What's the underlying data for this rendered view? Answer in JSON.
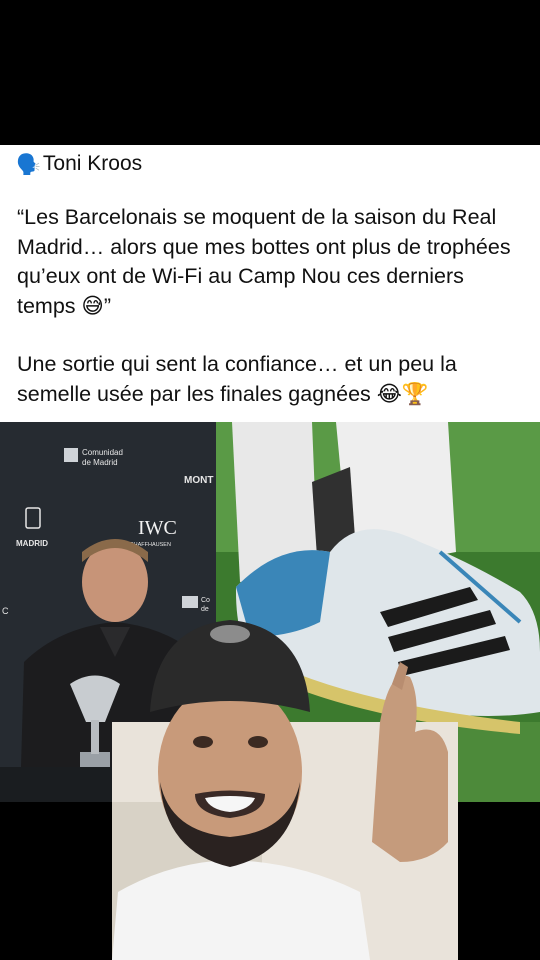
{
  "post": {
    "author_emoji": "🗣️",
    "author_name": "Toni Kroos",
    "quote": "“Les Barcelonais se moquent de la saison du Real Madrid… alors que mes bottes ont plus de trophées qu’eux ont de Wi-Fi au Camp Nou ces derniers temps 😅”",
    "comment": "Une sortie qui sent la confiance… et un peu la semelle usée par les finales gagnées 😂🏆"
  },
  "media": {
    "backdrop_texts": {
      "comunidad": "Comunidad",
      "de_madrid": "de Madrid",
      "madrid": "MADRID",
      "iwc": "IWC",
      "schaffhausen": "SCHAFFHAUSEN",
      "mont": "MONT",
      "co": "Co",
      "de": "de",
      "c": "C"
    },
    "colors": {
      "backdrop": "#2b3036",
      "grass": "#3c7a2e",
      "boot_blue": "#3a86b8",
      "sock": "#e8e8e8",
      "cap": "#2a2a2a",
      "skin": "#c89a7a"
    }
  }
}
